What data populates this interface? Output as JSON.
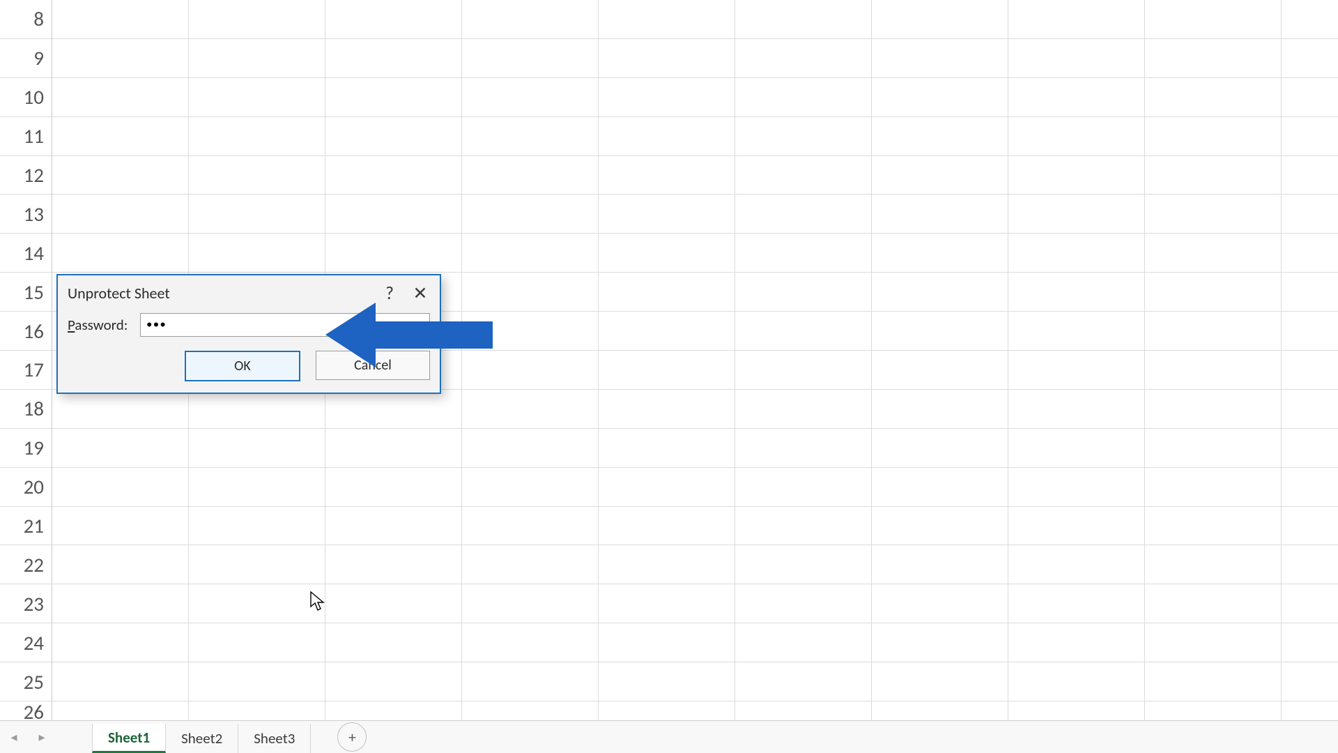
{
  "rows": [
    "8",
    "9",
    "10",
    "11",
    "12",
    "13",
    "14",
    "15",
    "16",
    "17",
    "18",
    "19",
    "20",
    "21",
    "22",
    "23",
    "24",
    "25",
    "26"
  ],
  "dialog": {
    "title": "Unprotect Sheet",
    "help": "?",
    "close": "✕",
    "password_label_pre": "P",
    "password_label_post": "assword:",
    "password_value": "•••",
    "ok": "OK",
    "cancel": "Cancel"
  },
  "tabs": {
    "nav_prev": "◂",
    "nav_next": "▸",
    "items": [
      "Sheet1",
      "Sheet2",
      "Sheet3"
    ],
    "active_index": 0,
    "add": "+"
  },
  "colors": {
    "dialog_border": "#1e71b8",
    "arrow": "#1e62c2",
    "tab_active": "#1a7a3f"
  }
}
